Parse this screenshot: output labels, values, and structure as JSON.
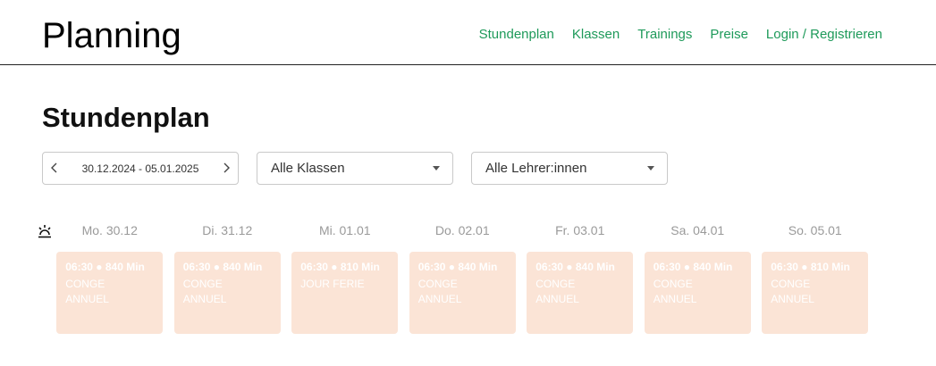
{
  "header": {
    "brand": "Planning",
    "nav": [
      "Stundenplan",
      "Klassen",
      "Trainings",
      "Preise",
      "Login / Registrieren"
    ]
  },
  "page": {
    "title": "Stundenplan"
  },
  "filters": {
    "date_range": "30.12.2024 - 05.01.2025",
    "prev_icon": "chevron-left-icon",
    "next_icon": "chevron-right-icon",
    "classes_value": "Alle Klassen",
    "teachers_value": "Alle Lehrer:innen"
  },
  "schedule": {
    "row_icon": "sunrise-icon",
    "days": [
      {
        "label": "Mo. 30.12",
        "time": "06:30 ● 840 Min",
        "desc": "CONGE ANNUEL"
      },
      {
        "label": "Di. 31.12",
        "time": "06:30 ● 840 Min",
        "desc": "CONGE ANNUEL"
      },
      {
        "label": "Mi. 01.01",
        "time": "06:30 ● 810 Min",
        "desc": "JOUR FERIE"
      },
      {
        "label": "Do. 02.01",
        "time": "06:30 ● 840 Min",
        "desc": "CONGE ANNUEL"
      },
      {
        "label": "Fr. 03.01",
        "time": "06:30 ● 840 Min",
        "desc": "CONGE ANNUEL"
      },
      {
        "label": "Sa. 04.01",
        "time": "06:30 ● 840 Min",
        "desc": "CONGE ANNUEL"
      },
      {
        "label": "So. 05.01",
        "time": "06:30 ● 810 Min",
        "desc": "CONGE ANNUEL"
      }
    ]
  },
  "colors": {
    "accent": "#1e9a5a",
    "card_bg": "#fbe4d6",
    "day_label": "#9a9a9a"
  }
}
